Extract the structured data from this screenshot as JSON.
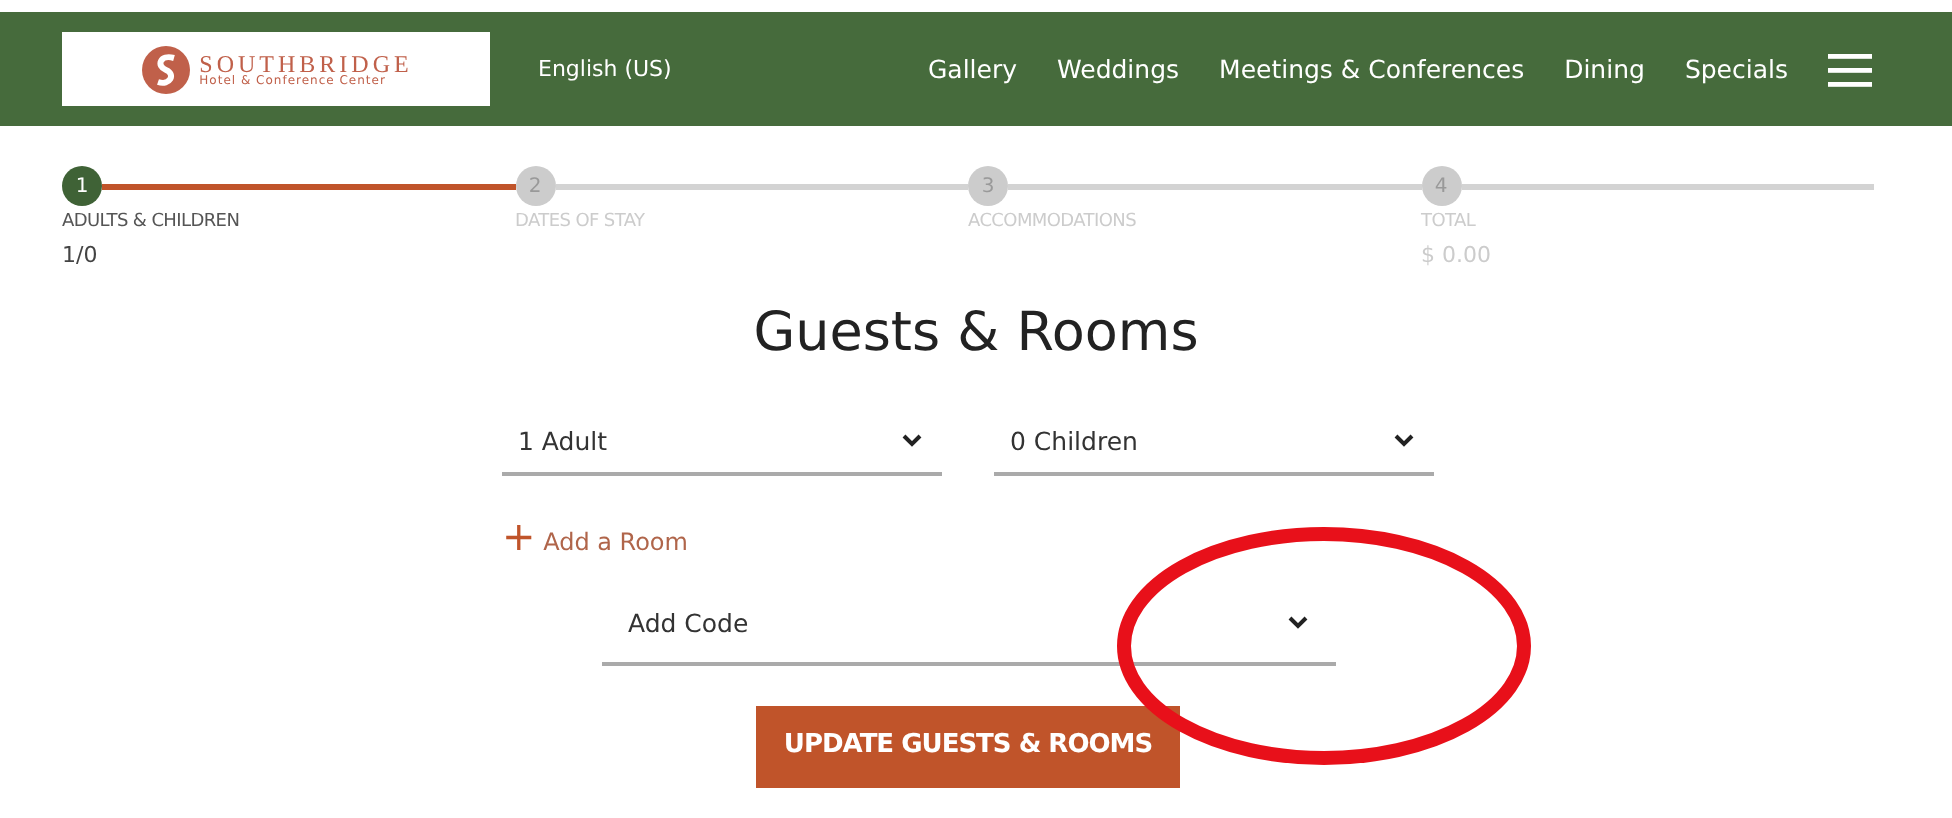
{
  "header": {
    "logo": {
      "name": "SOUTHBRIDGE",
      "tagline": "Hotel & Conference Center"
    },
    "language": "English (US)",
    "nav": [
      "Gallery",
      "Weddings",
      "Meetings & Conferences",
      "Dining",
      "Specials"
    ]
  },
  "steps": [
    {
      "number": "1",
      "label": "ADULTS & CHILDREN",
      "value": "1/0",
      "selected": true
    },
    {
      "number": "2",
      "label": "DATES OF STAY",
      "selected": false
    },
    {
      "number": "3",
      "label": "ACCOMMODATIONS",
      "selected": false
    },
    {
      "number": "4",
      "label": "TOTAL",
      "value": "$ 0.00",
      "selected": false
    }
  ],
  "title": "Guests & Rooms",
  "selects": [
    {
      "value": "1 Adult"
    },
    {
      "value": "0 Children"
    }
  ],
  "add_room": {
    "icon": "+",
    "label": "Add a Room"
  },
  "code_select": {
    "value": "Add Code"
  },
  "button": "UPDATE GUESTS & ROOMS"
}
